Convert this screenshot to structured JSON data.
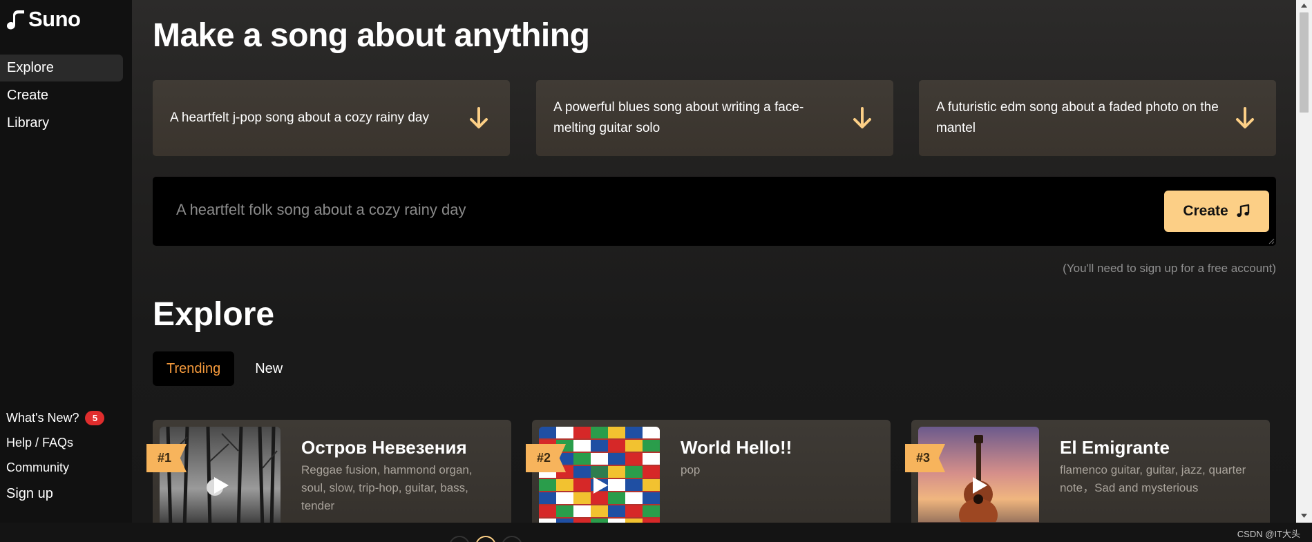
{
  "brand": {
    "name": "Suno"
  },
  "sidebar": {
    "items": [
      {
        "label": "Explore",
        "active": true
      },
      {
        "label": "Create"
      },
      {
        "label": "Library"
      }
    ],
    "bottom": {
      "whats_new": "What's New?",
      "whats_new_count": "5",
      "help": "Help / FAQs",
      "community": "Community",
      "signup": "Sign up"
    }
  },
  "hero": {
    "title": "Make a song about anything",
    "prompts": [
      "A heartfelt j-pop song about a cozy rainy day",
      "A powerful blues song about writing a face-melting guitar solo",
      "A futuristic edm song about a faded photo on the mantel"
    ],
    "input_placeholder": "A heartfelt folk song about a cozy rainy day",
    "create_label": "Create",
    "signup_note": "(You'll need to sign up for a free account)"
  },
  "explore": {
    "title": "Explore",
    "tabs": [
      {
        "label": "Trending",
        "active": true
      },
      {
        "label": "New"
      }
    ],
    "songs": [
      {
        "rank": "#1",
        "title": "Остров Невезения",
        "tags": "Reggae fusion, hammond organ, soul, slow, trip-hop, guitar, bass, tender"
      },
      {
        "rank": "#2",
        "title": "World Hello!!",
        "tags": "pop"
      },
      {
        "rank": "#3",
        "title": "El Emigrante",
        "tags": "flamenco guitar, guitar, jazz, quarter note，Sad and mysterious"
      }
    ]
  },
  "watermark": "CSDN @IT大头",
  "colors": {
    "accent": "#fccf86",
    "trending": "#f59a3c",
    "badge": "#e02d2d",
    "rank_flag": "#f7b45c"
  }
}
